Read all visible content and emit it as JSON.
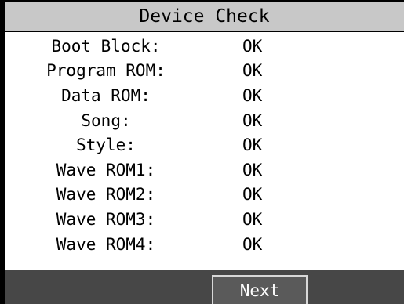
{
  "title": "Device Check",
  "rows": [
    {
      "label": "Boot Block:",
      "value": "OK"
    },
    {
      "label": "Program ROM:",
      "value": "OK"
    },
    {
      "label": "Data ROM:",
      "value": "OK"
    },
    {
      "label": "Song:",
      "value": "OK"
    },
    {
      "label": "Style:",
      "value": "OK"
    },
    {
      "label": "Wave ROM1:",
      "value": "OK"
    },
    {
      "label": "Wave ROM2:",
      "value": "OK"
    },
    {
      "label": "Wave ROM3:",
      "value": "OK"
    },
    {
      "label": "Wave ROM4:",
      "value": "OK"
    }
  ],
  "footer": {
    "next_label": "Next"
  },
  "colors": {
    "title_background": "#c8c8c8",
    "footer_background": "#474747",
    "text": "#000000"
  }
}
